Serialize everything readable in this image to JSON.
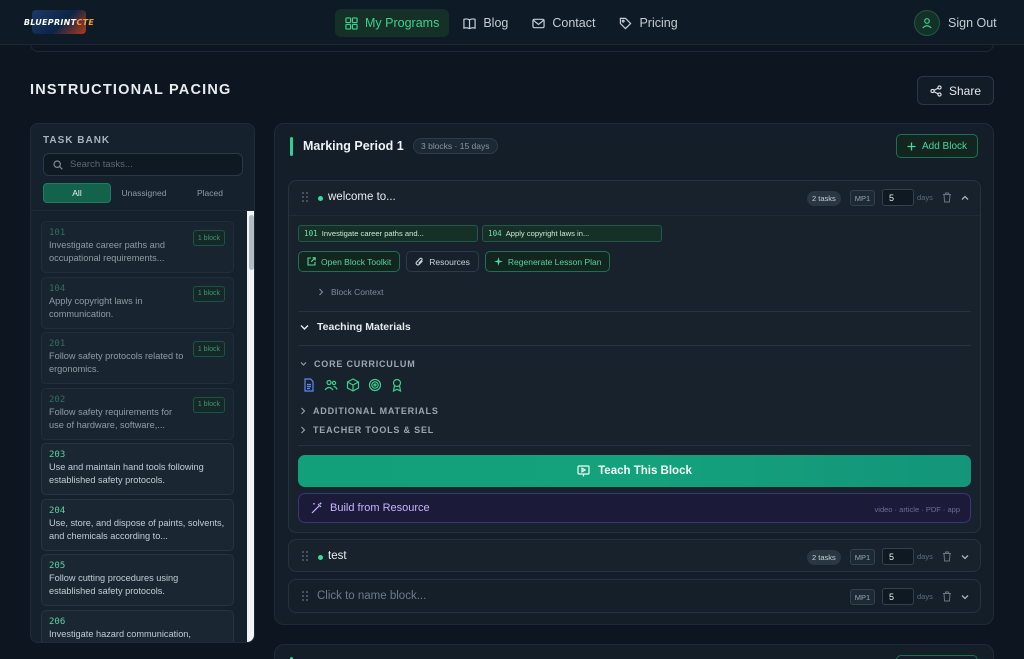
{
  "app": {
    "logo_text_1": "BLUEPRINT",
    "logo_text_2": "CTE"
  },
  "nav": {
    "links": [
      {
        "label": "My Programs",
        "icon": "grid-icon",
        "active": true
      },
      {
        "label": "Blog",
        "icon": "book-icon"
      },
      {
        "label": "Contact",
        "icon": "mail-icon"
      },
      {
        "label": "Pricing",
        "icon": "tag-icon"
      }
    ],
    "sign_out": "Sign Out"
  },
  "page": {
    "title": "INSTRUCTIONAL PACING",
    "share_label": "Share"
  },
  "task_bank": {
    "title": "TASK BANK",
    "search_placeholder": "Search tasks...",
    "filters": [
      "All",
      "Unassigned",
      "Placed"
    ],
    "active_filter": "All",
    "tasks": [
      {
        "code": "101",
        "text": "Investigate career paths and occupational requirements...",
        "badge": "1 block",
        "placed": true
      },
      {
        "code": "104",
        "text": "Apply copyright laws in communication.",
        "badge": "1 block",
        "placed": true
      },
      {
        "code": "201",
        "text": "Follow safety protocols related to ergonomics.",
        "badge": "1 block",
        "placed": true
      },
      {
        "code": "202",
        "text": "Follow safety requirements for use of hardware, software,...",
        "badge": "1 block",
        "placed": true
      },
      {
        "code": "203",
        "text": "Use and maintain hand tools following established safety protocols.",
        "badge": "",
        "placed": false
      },
      {
        "code": "204",
        "text": "Use, store, and dispose of paints, solvents, and chemicals according to...",
        "badge": "",
        "placed": false
      },
      {
        "code": "205",
        "text": "Follow cutting procedures using established safety protocols.",
        "badge": "",
        "placed": false
      },
      {
        "code": "206",
        "text": "Investigate hazard communication,",
        "badge": "",
        "placed": false
      }
    ]
  },
  "marking_period": {
    "title": "Marking Period 1",
    "meta": "3 blocks · 15 days",
    "add_block_label": "Add Block",
    "blocks": [
      {
        "name": "welcome to...",
        "tasks": "2 tasks",
        "mp": "MP1",
        "days": "5",
        "days_label": "days",
        "expanded": true,
        "chips": [
          {
            "code": "101",
            "text": "Investigate career paths and..."
          },
          {
            "code": "104",
            "text": "Apply copyright laws in..."
          }
        ],
        "actions": {
          "open_toolkit": "Open Block Toolkit",
          "resources": "Resources",
          "regenerate": "Regenerate Lesson Plan"
        },
        "block_context": "Block Context",
        "teaching_materials": "Teaching Materials",
        "categories": {
          "core": "CORE CURRICULUM",
          "additional": "ADDITIONAL MATERIALS",
          "teacher": "TEACHER TOOLS & SEL"
        },
        "core_icons": [
          "document-icon",
          "users-icon",
          "cube-icon",
          "target-icon",
          "award-icon"
        ],
        "teach_label": "Teach This Block",
        "build_label": "Build from Resource",
        "build_types": "video · article · PDF · app"
      },
      {
        "name": "test",
        "tasks": "2 tasks",
        "mp": "MP1",
        "days": "5",
        "days_label": "days"
      },
      {
        "name": "Click to name block...",
        "mp": "MP1",
        "days": "5",
        "days_label": "days"
      }
    ]
  },
  "colors": {
    "accent": "#3ecf8e",
    "teach_button": "#11a07a",
    "build_bg": "#1b1a39"
  }
}
